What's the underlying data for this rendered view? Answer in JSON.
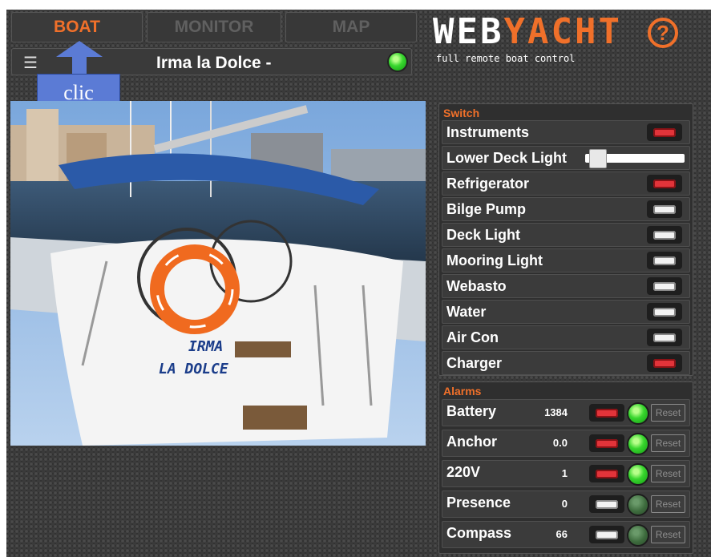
{
  "tabs": [
    {
      "label": "BOAT",
      "active": true
    },
    {
      "label": "MONITOR",
      "active": false
    },
    {
      "label": "MAP",
      "active": false
    }
  ],
  "logo": {
    "web": "WEB",
    "yacht": "YACHT",
    "help": "?",
    "tagline": "full remote boat control"
  },
  "header": {
    "menu_icon": "menu-icon",
    "boat_name": "Irma la Dolce -",
    "status": "online"
  },
  "annotation": {
    "text": "clic"
  },
  "photo": {
    "hull_text_1": "IRMA",
    "hull_text_2": "LA DOLCE"
  },
  "switch_panel": {
    "title": "Switch",
    "items": [
      {
        "label": "Instruments",
        "state": "on"
      },
      {
        "label": "Lower Deck Light",
        "type": "slider",
        "level": 0.05
      },
      {
        "label": "Refrigerator",
        "state": "on"
      },
      {
        "label": "Bilge Pump",
        "state": "off"
      },
      {
        "label": "Deck Light",
        "state": "off"
      },
      {
        "label": "Mooring Light",
        "state": "off"
      },
      {
        "label": "Webasto",
        "state": "off"
      },
      {
        "label": "Water",
        "state": "off"
      },
      {
        "label": "Air Con",
        "state": "off"
      },
      {
        "label": "Charger",
        "state": "on"
      }
    ]
  },
  "alarm_panel": {
    "title": "Alarms",
    "reset_label": "Reset",
    "items": [
      {
        "label": "Battery",
        "value": "1384",
        "armed": "on",
        "led": "on"
      },
      {
        "label": "Anchor",
        "value": "0.0",
        "armed": "on",
        "led": "on"
      },
      {
        "label": "220V",
        "value": "1",
        "armed": "on",
        "led": "on"
      },
      {
        "label": "Presence",
        "value": "0",
        "armed": "off",
        "led": "dim"
      },
      {
        "label": "Compass",
        "value": "66",
        "armed": "off",
        "led": "dim"
      }
    ]
  },
  "colors": {
    "accent": "#f0702a",
    "led_on": "#38d62e",
    "switch_on": "#e2343a",
    "annotation": "#5b7bd5"
  }
}
